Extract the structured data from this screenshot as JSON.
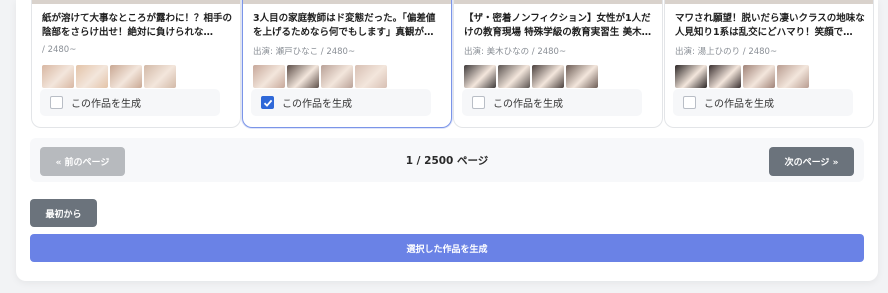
{
  "cards": [
    {
      "title": "紙が溶けて大事なところが露わに！？相手の陰部をさらけ出せ！絶対に負けられな…",
      "meta": "/ 2480~",
      "generate_label": "この作品を生成",
      "checked": false,
      "thumb_colors": [
        "#d8b7a2",
        "#e3c3a8",
        "#c9a893",
        "#d2b9a7"
      ]
    },
    {
      "title": "3人目の家庭教師はド変態だった。「偏差値を上げるためなら何でもします」真観が…",
      "meta": "出演: 瀬戸ひなこ / 2480~",
      "generate_label": "この作品を生成",
      "checked": true,
      "thumb_colors": [
        "#c7a89a",
        "#5d4f49",
        "#b9a197",
        "#d7bfb3"
      ]
    },
    {
      "title": "【ザ・密着ノンフィクション】女性が1人だけの教育現場 特殊学級の教育実習生 美木…",
      "meta": "出演: 美木ひなの / 2480~",
      "generate_label": "この作品を生成",
      "checked": false,
      "thumb_colors": [
        "#3e3a3a",
        "#5a5350",
        "#4a403d",
        "#6c5c55"
      ]
    },
    {
      "title": "マワされ願望！脱いだら凄いクラスの地味な人見知り1系は乱交にどハマり！笑顔で…",
      "meta": "出演: 湯上ひのり / 2480~",
      "generate_label": "この作品を生成",
      "checked": false,
      "thumb_colors": [
        "#2b2626",
        "#3a3030",
        "#a08378",
        "#b89c90"
      ]
    }
  ],
  "pagination": {
    "prev_label": "« 前のページ",
    "page_info": "1 / 2500 ページ",
    "next_label": "次のページ »"
  },
  "first_label": "最初から",
  "submit_label": "選択した作品を生成"
}
